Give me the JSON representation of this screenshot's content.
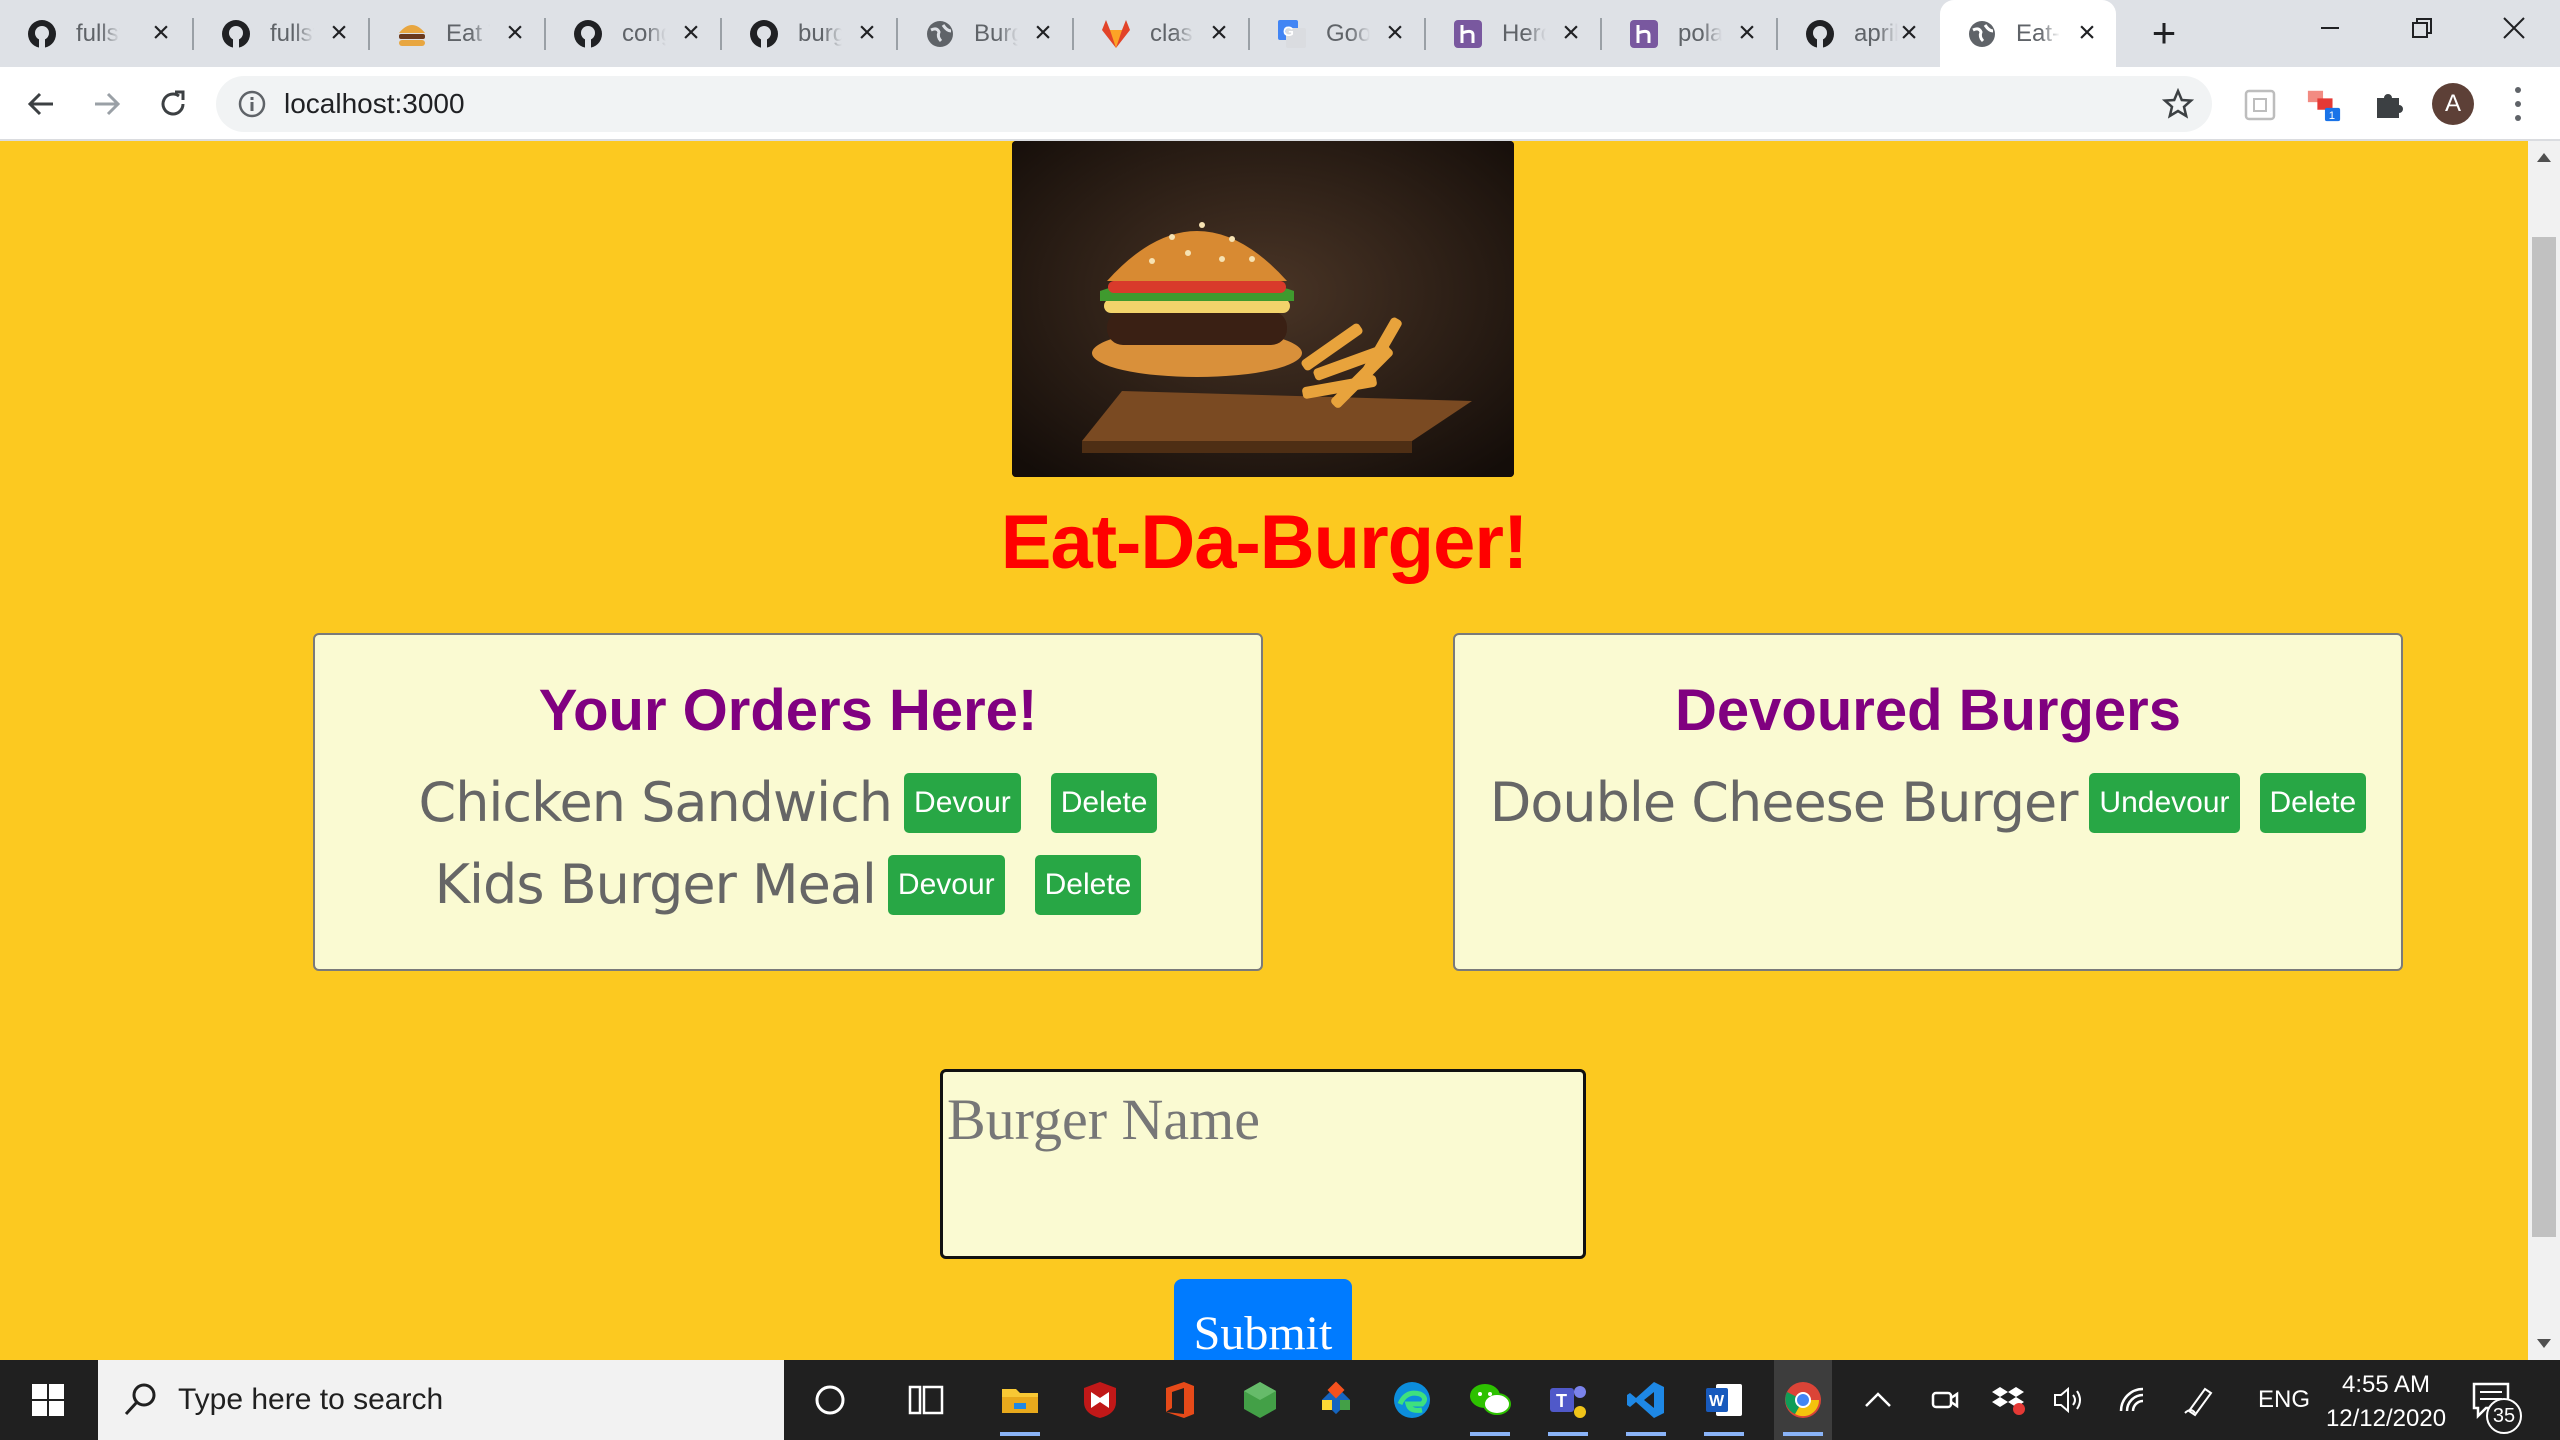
{
  "browser": {
    "tabs": [
      {
        "title": "fullst",
        "icon": "github-icon"
      },
      {
        "title": "fullst",
        "icon": "github-icon"
      },
      {
        "title": "Eat T",
        "icon": "burger-icon"
      },
      {
        "title": "cong",
        "icon": "github-icon"
      },
      {
        "title": "burg",
        "icon": "github-icon"
      },
      {
        "title": "Burg",
        "icon": "globe-icon"
      },
      {
        "title": "class",
        "icon": "gitlab-icon"
      },
      {
        "title": "Goo",
        "icon": "google-translate-icon"
      },
      {
        "title": "Hero",
        "icon": "heroku-icon"
      },
      {
        "title": "pola",
        "icon": "heroku-icon"
      },
      {
        "title": "april",
        "icon": "github-icon"
      },
      {
        "title": "Eat-",
        "icon": "globe-icon",
        "active": true
      }
    ],
    "url": "localhost:3000",
    "profile_initial": "A",
    "extension_badge": "1"
  },
  "page": {
    "title": "Eat-Da-Burger!",
    "orders": {
      "heading": "Your Orders Here!",
      "items": [
        {
          "name": "Chicken Sandwich",
          "action": "Devour",
          "delete": "Delete"
        },
        {
          "name": "Kids Burger Meal",
          "action": "Devour",
          "delete": "Delete"
        }
      ]
    },
    "devoured": {
      "heading": "Devoured Burgers",
      "items": [
        {
          "name": "Double Cheese Burger",
          "action": "Undevour",
          "delete": "Delete"
        }
      ]
    },
    "form": {
      "placeholder": "Burger Name",
      "submit_label": "Submit"
    }
  },
  "taskbar": {
    "search_placeholder": "Type here to search",
    "language": "ENG",
    "time": "4:55 AM",
    "date": "12/12/2020",
    "notification_count": "35"
  },
  "colors": {
    "page_background": "#fcc920",
    "title": "#ff0000",
    "card_heading": "#800080",
    "card_background": "#fafad2",
    "action_button": "#28a745",
    "submit_button": "#007bff"
  }
}
